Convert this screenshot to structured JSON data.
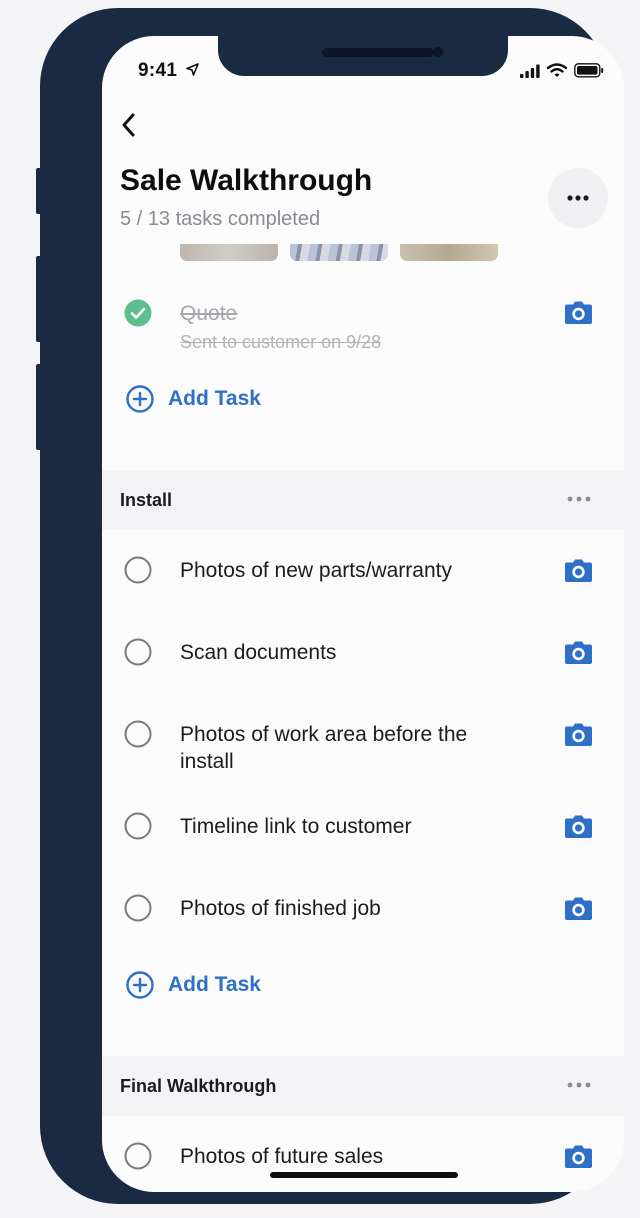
{
  "status_bar": {
    "time": "9:41"
  },
  "header": {
    "back_label": "back",
    "title": "Sale Walkthrough",
    "subtitle": "5 / 13 tasks completed"
  },
  "colors": {
    "accent": "#2e6fc8",
    "done": "#5bbf8e",
    "frame": "#1a2a42"
  },
  "completed_task": {
    "label": "Quote",
    "note": "Sent to customer on 9/28"
  },
  "add_task_label": "Add Task",
  "sections": [
    {
      "title": "Install",
      "tasks": [
        {
          "label": "Photos of new parts/warranty"
        },
        {
          "label": "Scan documents"
        },
        {
          "label": "Photos of work area before the install"
        },
        {
          "label": "Timeline link to customer"
        },
        {
          "label": "Photos of finished job"
        }
      ]
    },
    {
      "title": "Final Walkthrough",
      "tasks": [
        {
          "label": "Photos of future sales"
        }
      ]
    }
  ]
}
